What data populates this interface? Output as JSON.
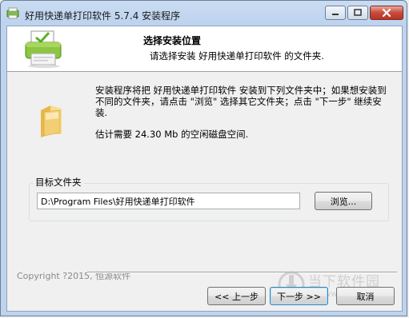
{
  "window": {
    "title": "好用快递单打印软件 5.7.4 安装程序"
  },
  "header": {
    "title": "选择安装位置",
    "subtitle": "请选择安装 好用快递单打印软件 的文件夹."
  },
  "body": {
    "intro": "安装程序将把 好用快递单打印软件 安装到下列文件夹中；如果想安装到不同的文件夹，请点击 \"浏览\" 选择其它文件夹；点击 \"下一步\" 继续安装.",
    "space_required": "估计需要 24.30 Mb 的空闲磁盘空间."
  },
  "destination": {
    "legend": "目标文件夹",
    "path": "D:\\Program Files\\好用快递单打印软件",
    "browse_label": "浏览..."
  },
  "footer": {
    "copyright": "Copyright  ?2015, 恒源软件",
    "back_label": "<< 上一步",
    "next_label": "下一步 >>",
    "cancel_label": "取消"
  },
  "watermark": {
    "text": "当下软件园",
    "url": "www.downxia.com"
  },
  "colors": {
    "titlebar": "#bdd3ee",
    "close_button": "#c7493b",
    "header_bg": "#ffffff",
    "dialog_bg": "#f0f0f0"
  }
}
